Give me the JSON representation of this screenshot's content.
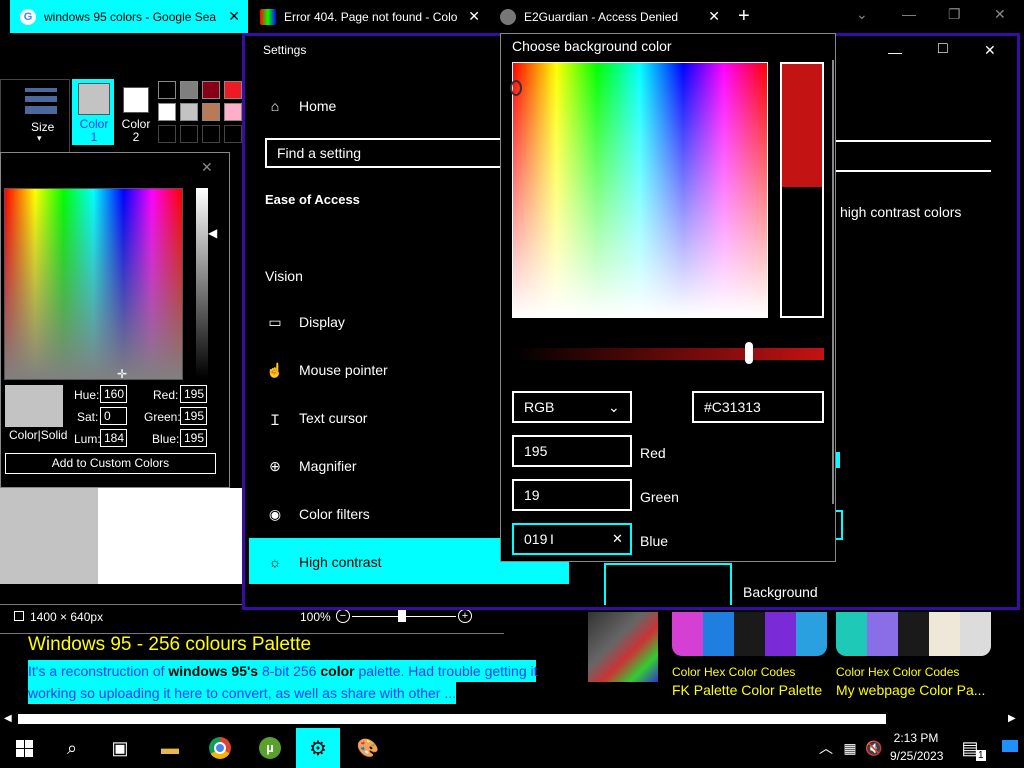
{
  "browser": {
    "tabs": [
      {
        "label": "windows 95 colors - Google Sea"
      },
      {
        "label": "Error 404. Page not found - Colo"
      },
      {
        "label": "E2Guardian - Access Denied"
      }
    ],
    "new_tab": "+",
    "minimize": "—",
    "restore": "❐",
    "close": "✕",
    "tab_list": "⌄"
  },
  "paint": {
    "size_label": "Size",
    "color1_label": "Color 1",
    "color2_label": "Color 2",
    "palette": [
      "#000000",
      "#7f7f7f",
      "#880015",
      "#ed1c24",
      "#ffffff",
      "#c3c3c3",
      "#b97a57",
      "#ffaec9"
    ],
    "status_dims": "1400 × 640px",
    "zoom": "100%",
    "partial_label": "Co"
  },
  "color_dialog": {
    "close": "✕",
    "solid_label": "Color|Solid",
    "hue_label": "Hue:",
    "hue_value": "160",
    "sat_label": "Sat:",
    "sat_value": "0",
    "lum_label": "Lum:",
    "lum_value": "184",
    "red_label": "Red:",
    "red_value": "195",
    "green_label": "Green:",
    "green_value": "195",
    "blue_label": "Blue:",
    "blue_value": "195",
    "add_button": "Add to Custom Colors"
  },
  "settings": {
    "title": "Settings",
    "home": "Home",
    "search_placeholder": "Find a setting",
    "section": "Ease of Access",
    "group": "Vision",
    "nav": [
      {
        "label": "Display",
        "icon": "monitor-icon"
      },
      {
        "label": "Mouse pointer",
        "icon": "pointer-icon"
      },
      {
        "label": "Text cursor",
        "icon": "text-cursor-icon"
      },
      {
        "label": "Magnifier",
        "icon": "magnifier-icon"
      },
      {
        "label": "Color filters",
        "icon": "palette-icon"
      },
      {
        "label": "High contrast",
        "icon": "sun-icon"
      }
    ],
    "right_text": "high contrast colors",
    "background_label": "Background",
    "win_minimize": "—",
    "win_maximize": "□",
    "win_close": "✕"
  },
  "picker": {
    "title": "Choose background color",
    "mode": "RGB",
    "hex": "#C31313",
    "red_value": "195",
    "red_label": "Red",
    "green_value": "19",
    "green_label": "Green",
    "blue_value": "019",
    "blue_label": "Blue",
    "clear": "✕",
    "selected_color": "#C31313",
    "slider_level": 0.76
  },
  "web": {
    "heading": "Windows 95 - 256 colours Palette",
    "snippet_1a": "It's a reconstruction of ",
    "snippet_1b": "windows 95's",
    "snippet_1c": " 8-bit 256 ",
    "snippet_1d": "color",
    "snippet_1e": " palette. Had trouble getting it",
    "snippet_2": "working so uploading it here to convert, as well as share with other ...",
    "card1_source": "Color Hex Color Codes",
    "card1_title": "FK Palette Color Palette",
    "card2_source": "Color Hex Color Codes",
    "card2_title": "My webpage Color Pa...",
    "card1_swatches": [
      "#d43fd4",
      "#1f7fe0",
      "#1a1a1a",
      "#7a2ad6",
      "#2aa0e0"
    ],
    "card2_swatches": [
      "#1fc9b8",
      "#8a6ee8",
      "#1a1a1a",
      "#efe8d8",
      "#dcdcdc"
    ]
  },
  "taskbar": {
    "time": "2:13 PM",
    "date": "9/25/2023",
    "notifications": "1"
  }
}
